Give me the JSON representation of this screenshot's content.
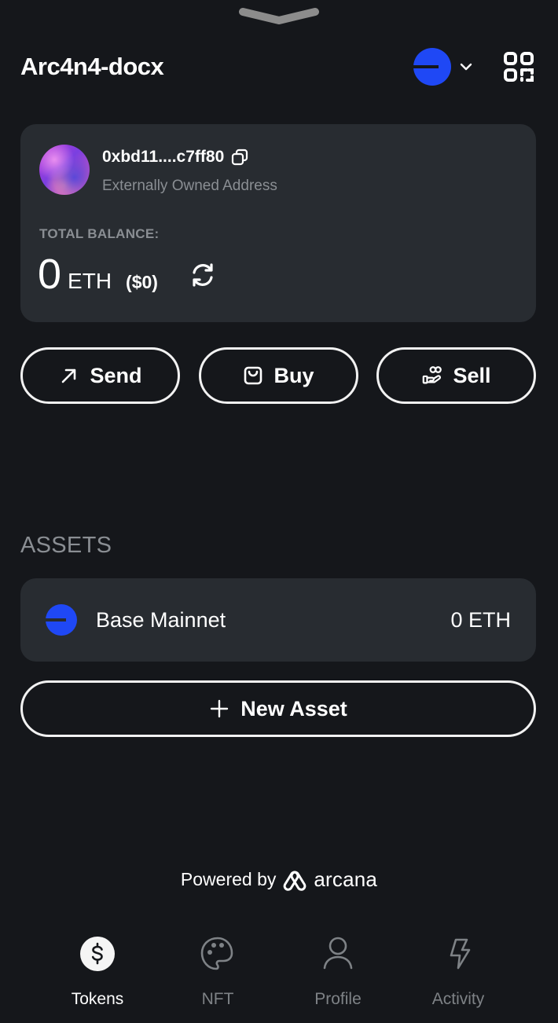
{
  "header": {
    "title": "Arc4n4-docx",
    "chain_color": "#1f48f5",
    "chain_icon": "base-network-icon",
    "dropdown_icon": "chevron-down-icon",
    "qr_icon": "qr-scan-icon"
  },
  "account": {
    "address": "0xbd11....c7ff80",
    "address_type": "Externally Owned Address",
    "copy_icon": "copy-icon",
    "balance_label": "TOTAL BALANCE:",
    "balance_amount": "0",
    "balance_unit": "ETH",
    "balance_fiat": "($0)",
    "refresh_icon": "refresh-icon"
  },
  "actions": [
    {
      "label": "Send",
      "icon": "arrow-up-right-icon"
    },
    {
      "label": "Buy",
      "icon": "shopping-bag-icon"
    },
    {
      "label": "Sell",
      "icon": "hand-coins-icon"
    }
  ],
  "assets": {
    "title": "ASSETS",
    "items": [
      {
        "name": "Base Mainnet",
        "value": "0 ETH",
        "icon": "base-network-icon"
      }
    ],
    "new_asset_label": "New Asset"
  },
  "footer": {
    "powered_by": "Powered by",
    "brand": "arcana"
  },
  "nav": {
    "items": [
      {
        "label": "Tokens",
        "icon": "dollar-circle-icon",
        "active": true
      },
      {
        "label": "NFT",
        "icon": "palette-icon",
        "active": false
      },
      {
        "label": "Profile",
        "icon": "user-icon",
        "active": false
      },
      {
        "label": "Activity",
        "icon": "lightning-icon",
        "active": false
      }
    ]
  },
  "colors": {
    "background": "#15171b",
    "card": "#282c31",
    "accent": "#1f48f5",
    "muted_text": "#8a8e93"
  }
}
